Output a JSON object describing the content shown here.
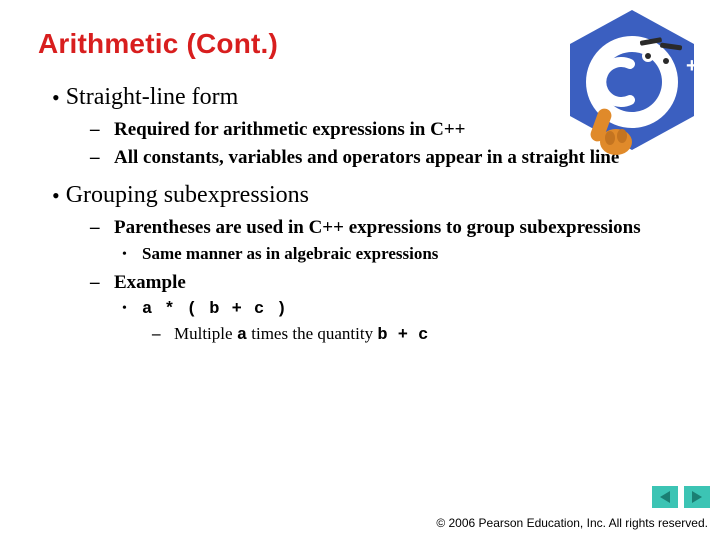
{
  "title": "Arithmetic (Cont.)",
  "logo": {
    "plusplus": "++"
  },
  "bullets": [
    {
      "text": "Straight-line form",
      "sub": [
        {
          "text": "Required for arithmetic expressions in C++"
        },
        {
          "text": "All constants, variables and operators appear in a straight line"
        }
      ]
    },
    {
      "text": "Grouping subexpressions",
      "sub": [
        {
          "text": "Parentheses are used in C++ expressions to group subexpressions",
          "sub": [
            {
              "text": "Same manner as in algebraic expressions"
            }
          ]
        },
        {
          "text": "Example",
          "sub": [
            {
              "code": "a * ( b + c )",
              "sub": [
                {
                  "pre": "Multiple ",
                  "code1": "a",
                  "mid": " times the quantity ",
                  "code2": "b + c"
                }
              ]
            }
          ]
        }
      ]
    }
  ],
  "copyright": "© 2006 Pearson Education, Inc.  All rights reserved."
}
